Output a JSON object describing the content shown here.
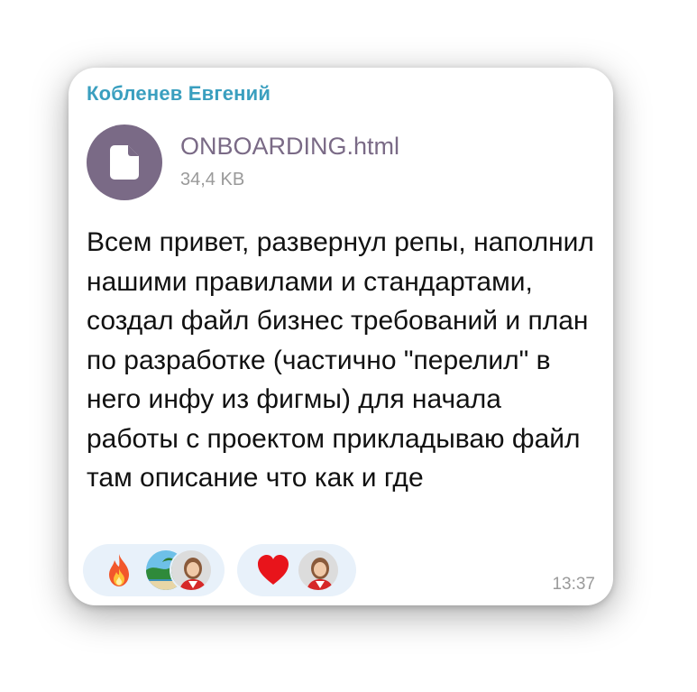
{
  "sender": "Кобленев Евгений",
  "file": {
    "name": "ONBOARDING.html",
    "size": "34,4 KB",
    "icon": "document-icon"
  },
  "message": "Всем привет, развернул репы, наполнил нашими правилами и стандартами, создал файл бизнес требований и план по разработке (частично \"перелил\" в него инфу из фигмы) для начала работы с проектом прикладываю файл там описание что как и где",
  "reactions": [
    {
      "emoji": "fire-icon",
      "avatars": [
        "beach-avatar",
        "user-avatar"
      ]
    },
    {
      "emoji": "heart-icon",
      "avatars": [
        "user-avatar"
      ]
    }
  ],
  "time": "13:37",
  "colors": {
    "sender": "#3a9fbf",
    "file_accent": "#7a6a86",
    "reaction_bg": "#e8f1fa",
    "meta": "#9a9a9a"
  }
}
